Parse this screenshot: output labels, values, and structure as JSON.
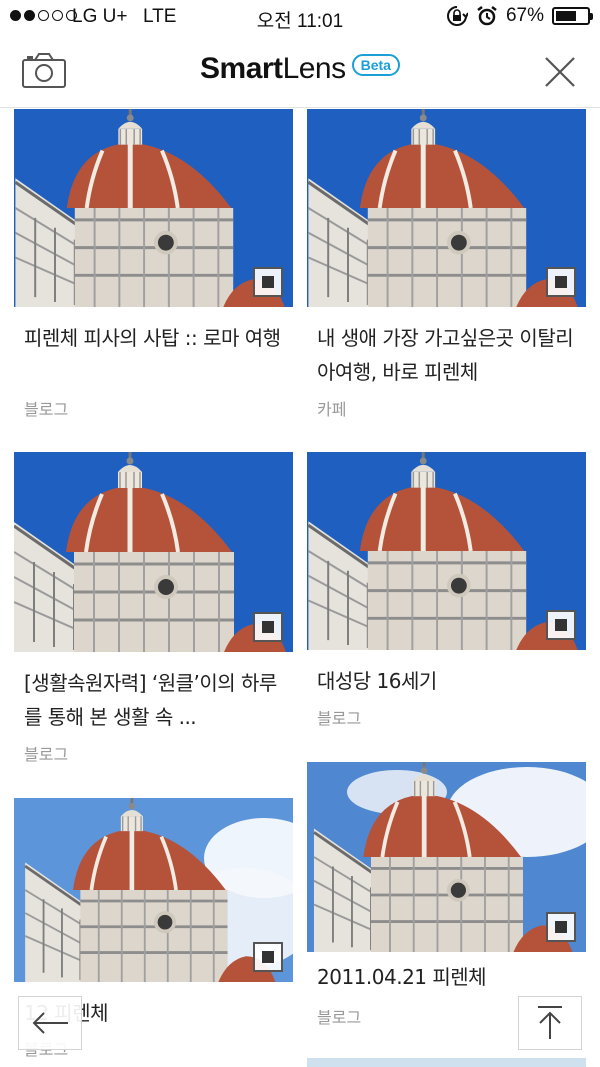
{
  "status_bar": {
    "carrier": "LG U+",
    "network": "LTE",
    "time": "오전 11:01",
    "battery": "67%",
    "battery_level": 0.67,
    "signal_bars": 2
  },
  "header": {
    "logo_primary": "Smart",
    "logo_secondary": "Lens",
    "badge": "Beta",
    "left_icon": "camera-icon",
    "right_icon": "close-icon"
  },
  "results": [
    {
      "title": "피렌체 피사의 사탑 :: 로마 여행",
      "source": "블로그",
      "icon": "image-icon"
    },
    {
      "title": "내 생애 가장 가고싶은곳 이탈리아여행, 바로 피렌체",
      "source": "카페",
      "icon": "image-icon"
    },
    {
      "title": "[생활속원자력] ‘원클’이의 하루를 통해 본 생활 속 ...",
      "source": "블로그",
      "icon": "image-icon"
    },
    {
      "title": "대성당 16세기",
      "source": "블로그",
      "icon": "image-icon"
    },
    {
      "title": "12 피렌체",
      "source": "블로그",
      "icon": "image-icon"
    },
    {
      "title": "2011.04.21 피렌체",
      "source": "블로그",
      "icon": "image-icon"
    }
  ],
  "floating": {
    "back_icon": "arrow-left-icon",
    "top_icon": "arrow-up-icon"
  },
  "colors": {
    "sky": "#1f5fbf",
    "dome": "#b5533a",
    "badge_accent": "#1a9fd8"
  }
}
